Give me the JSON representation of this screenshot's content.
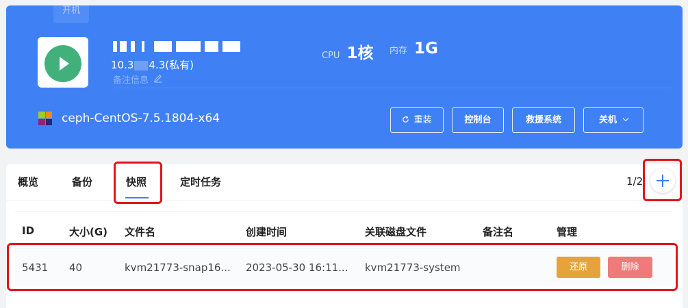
{
  "header": {
    "status_chip": "开机",
    "vm_ip_prefix": "10.3",
    "vm_ip_suffix": "4.3(私有)",
    "note_label": "备注信息",
    "cpu_label": "CPU",
    "cpu_value": "1核",
    "mem_label": "内存",
    "mem_value": "1G",
    "os_name": "ceph-CentOS-7.5.1804-x64",
    "buttons": {
      "reinstall": "重装",
      "console": "控制台",
      "rescue": "救援系统",
      "power": "关机"
    }
  },
  "tabs": [
    {
      "label": "概览"
    },
    {
      "label": "备份"
    },
    {
      "label": "快照"
    },
    {
      "label": "定时任务"
    }
  ],
  "active_tab": "快照",
  "pager": "1/2",
  "table": {
    "columns": [
      "ID",
      "大小(G)",
      "文件名",
      "创建时间",
      "关联磁盘文件",
      "备注名",
      "管理"
    ],
    "rows": [
      {
        "id": "5431",
        "size": "40",
        "filename": "kvm21773-snap16...",
        "created": "2023-05-30 16:11...",
        "disk": "kvm21773-system",
        "note": "",
        "restore_label": "还原",
        "delete_label": "删除"
      }
    ]
  },
  "colors": {
    "accent": "#3f80f5",
    "run_green": "#41b07a",
    "restore": "#e6a33b",
    "delete": "#ef7a7a",
    "highlight": "#e3141b"
  },
  "icons": [
    "play-icon",
    "pencil-icon",
    "refresh-icon",
    "chevron-down-icon",
    "plus-icon",
    "centos-icon"
  ]
}
